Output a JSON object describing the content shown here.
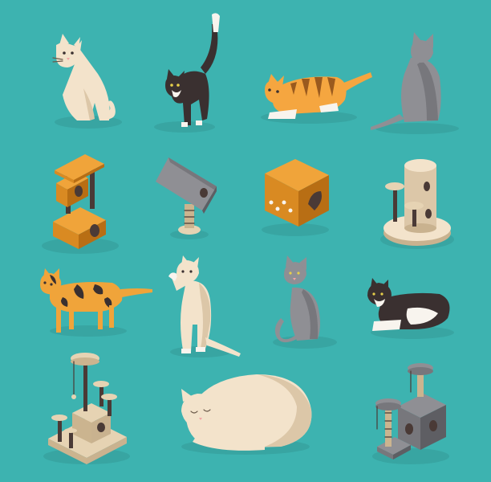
{
  "background": "#3db3b0",
  "palette": {
    "cream": "#f3e3cb",
    "cream_shade": "#dcc7a8",
    "cream_dark": "#c9b28f",
    "beige": "#e6d3b3",
    "beige_shade": "#cbb48f",
    "black": "#3a3030",
    "black_shade": "#2a2222",
    "white": "#f8f4ee",
    "gray": "#8f8f94",
    "gray_shade": "#77777c",
    "gray_dark": "#5e5e63",
    "orange": "#f0a43a",
    "orange_shade": "#d98a22",
    "orange_dark": "#b86e14",
    "tabby": "#f5a640",
    "tabby_stripe": "#9a5a1e",
    "pink": "#f2a5a5",
    "post": "#4a3a36",
    "shadow": "rgba(0,0,0,0.08)"
  },
  "items": [
    {
      "kind": "cat-sitting-cream"
    },
    {
      "kind": "cat-arching-black"
    },
    {
      "kind": "cat-crouching-tabby"
    },
    {
      "kind": "cat-sitting-gray-back"
    },
    {
      "kind": "tree-orange-tower"
    },
    {
      "kind": "scratcher-gray-triangle"
    },
    {
      "kind": "house-orange-cube"
    },
    {
      "kind": "tower-cream-round"
    },
    {
      "kind": "cat-walking-calico"
    },
    {
      "kind": "cat-standing-cream"
    },
    {
      "kind": "cat-sitting-gray"
    },
    {
      "kind": "cat-lying-tuxedo"
    },
    {
      "kind": "tree-beige-complex"
    },
    {
      "kind": "cat-sleeping-cream"
    },
    {
      "kind": "tree-gray-modern"
    }
  ]
}
